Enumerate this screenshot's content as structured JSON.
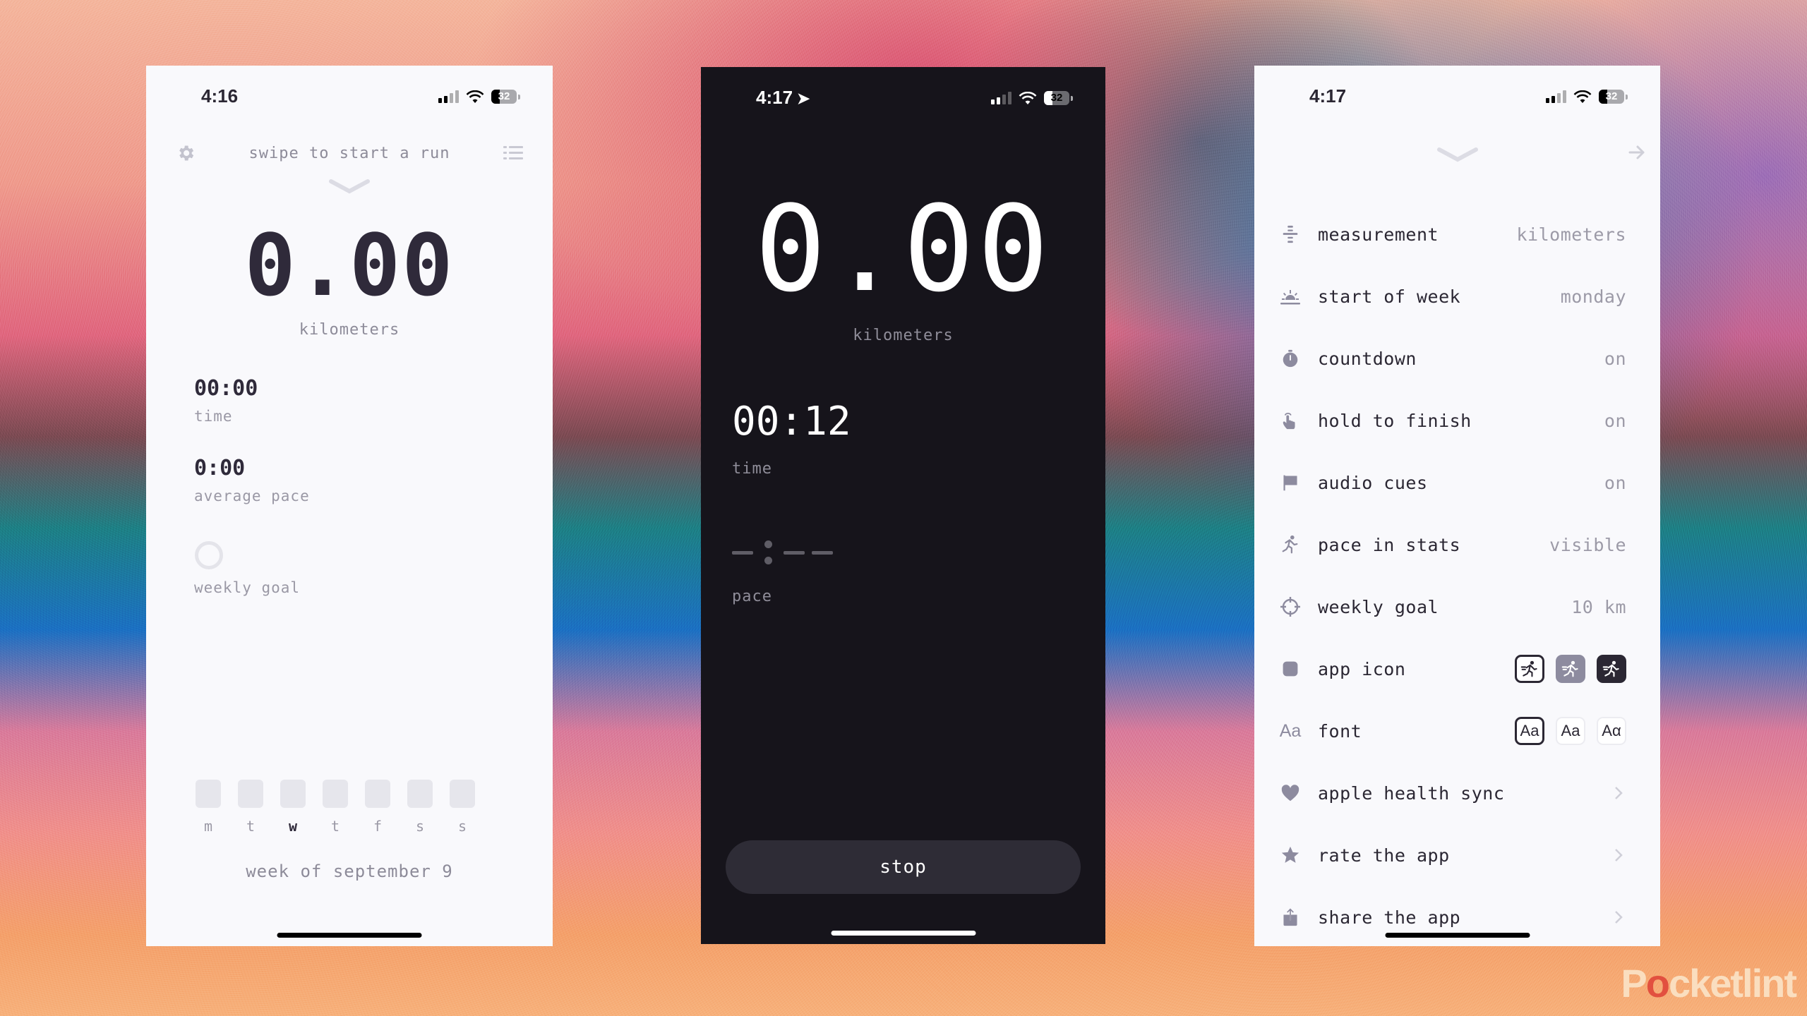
{
  "watermark": {
    "pre": "P",
    "o": "o",
    "post": "cketlint"
  },
  "phones": [
    {
      "theme": "light",
      "status": {
        "time": "4:16",
        "battery": "32",
        "battery_level": 0.32
      },
      "header": {
        "hint": "swipe to start a run"
      },
      "distance": {
        "value": "0.00",
        "unit": "kilometers"
      },
      "stats": [
        {
          "value": "00:00",
          "label": "time"
        },
        {
          "value": "0:00",
          "label": "average pace"
        }
      ],
      "weekly_goal": {
        "label": "weekly goal",
        "progress": 0
      },
      "week": {
        "days": [
          {
            "label": "m",
            "today": false
          },
          {
            "label": "t",
            "today": false
          },
          {
            "label": "w",
            "today": true
          },
          {
            "label": "t",
            "today": false
          },
          {
            "label": "f",
            "today": false
          },
          {
            "label": "s",
            "today": false
          },
          {
            "label": "s",
            "today": false
          }
        ],
        "caption": "week of september 9"
      }
    },
    {
      "theme": "dark",
      "status": {
        "time": "4:17",
        "location_active": true,
        "battery": "32",
        "battery_level": 0.32
      },
      "distance": {
        "value": "0.00",
        "unit": "kilometers"
      },
      "stats": [
        {
          "value": "00:12",
          "label": "time"
        },
        {
          "value": "-:--",
          "label": "pace"
        }
      ],
      "stop_label": "stop"
    },
    {
      "theme": "light",
      "status": {
        "time": "4:17",
        "battery": "32",
        "battery_level": 0.32
      },
      "settings": [
        {
          "icon": "measurement-icon",
          "label": "measurement",
          "value": "kilometers"
        },
        {
          "icon": "sunrise-icon",
          "label": "start of week",
          "value": "monday"
        },
        {
          "icon": "timer-icon",
          "label": "countdown",
          "value": "on"
        },
        {
          "icon": "hand-tap-icon",
          "label": "hold to finish",
          "value": "on"
        },
        {
          "icon": "flag-icon",
          "label": "audio cues",
          "value": "on"
        },
        {
          "icon": "runner-icon",
          "label": "pace in stats",
          "value": "visible"
        },
        {
          "icon": "target-icon",
          "label": "weekly goal",
          "value": "10 km"
        },
        {
          "icon": "app-icon-square",
          "label": "app icon",
          "options": [
            "light",
            "grey",
            "dark"
          ],
          "selected": 0
        },
        {
          "icon": "font-icon",
          "icon_text": "Aa",
          "label": "font",
          "options": [
            "Aa",
            "Aa",
            "Aα"
          ],
          "selected": 0
        },
        {
          "icon": "heart-icon",
          "label": "apple health sync",
          "chevron": true
        },
        {
          "icon": "star-icon",
          "label": "rate the app",
          "chevron": true
        },
        {
          "icon": "share-icon",
          "label": "share the app",
          "chevron": true
        }
      ]
    }
  ]
}
